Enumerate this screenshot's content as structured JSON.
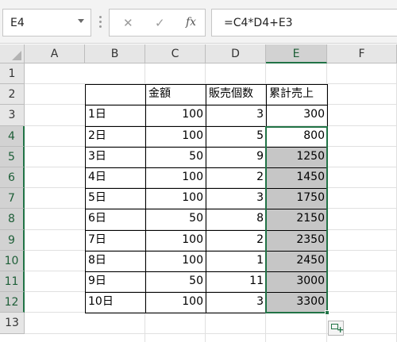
{
  "name_box": {
    "value": "E4"
  },
  "formula_bar": {
    "cancel_glyph": "✕",
    "enter_glyph": "✓",
    "fx_label": "fx",
    "formula": "=C4*D4+E3"
  },
  "columns": [
    "A",
    "B",
    "C",
    "D",
    "E",
    "F"
  ],
  "rows": [
    "1",
    "2",
    "3",
    "4",
    "5",
    "6",
    "7",
    "8",
    "9",
    "10",
    "11",
    "12",
    "13"
  ],
  "table": {
    "headers": {
      "C": "金額",
      "D": "販売個数",
      "E": "累計売上"
    },
    "data": [
      {
        "B": "1日",
        "C": "100",
        "D": "3",
        "E": "300"
      },
      {
        "B": "2日",
        "C": "100",
        "D": "5",
        "E": "800"
      },
      {
        "B": "3日",
        "C": "50",
        "D": "9",
        "E": "1250"
      },
      {
        "B": "4日",
        "C": "100",
        "D": "2",
        "E": "1450"
      },
      {
        "B": "5日",
        "C": "100",
        "D": "3",
        "E": "1750"
      },
      {
        "B": "6日",
        "C": "50",
        "D": "8",
        "E": "2150"
      },
      {
        "B": "7日",
        "C": "100",
        "D": "2",
        "E": "2350"
      },
      {
        "B": "8日",
        "C": "100",
        "D": "1",
        "E": "2450"
      },
      {
        "B": "9日",
        "C": "50",
        "D": "11",
        "E": "3000"
      },
      {
        "B": "10日",
        "C": "100",
        "D": "3",
        "E": "3300"
      }
    ]
  },
  "selection": {
    "range": "E4:E12"
  },
  "colors": {
    "accent": "#217346",
    "fill_shade": "#c6c6c6"
  },
  "icons": {
    "quick_analysis": "quick-analysis-icon"
  }
}
